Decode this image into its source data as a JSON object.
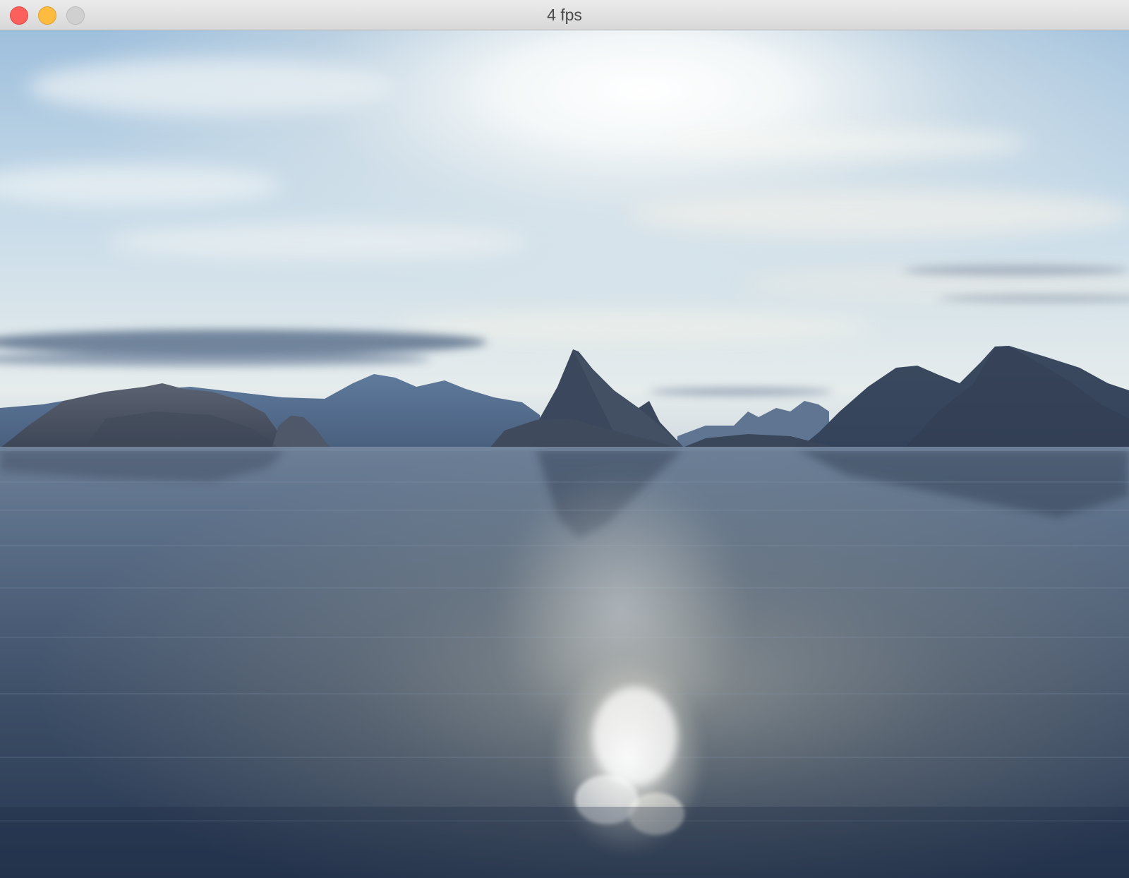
{
  "window": {
    "title": "4 fps"
  },
  "controls": {
    "close": "close-button",
    "minimize": "minimize-button",
    "zoom": "zoom-button"
  },
  "scene": {
    "colors": {
      "sky_top": "#9fc0dc",
      "sky_horizon": "#e8eef0",
      "sun": "#ffffff",
      "mountain_near": "#4a5566",
      "mountain_far": "#5a7090",
      "water_top": "#6d8099",
      "water_bottom": "#2a3a52",
      "sun_reflection": "#ffffff"
    }
  }
}
